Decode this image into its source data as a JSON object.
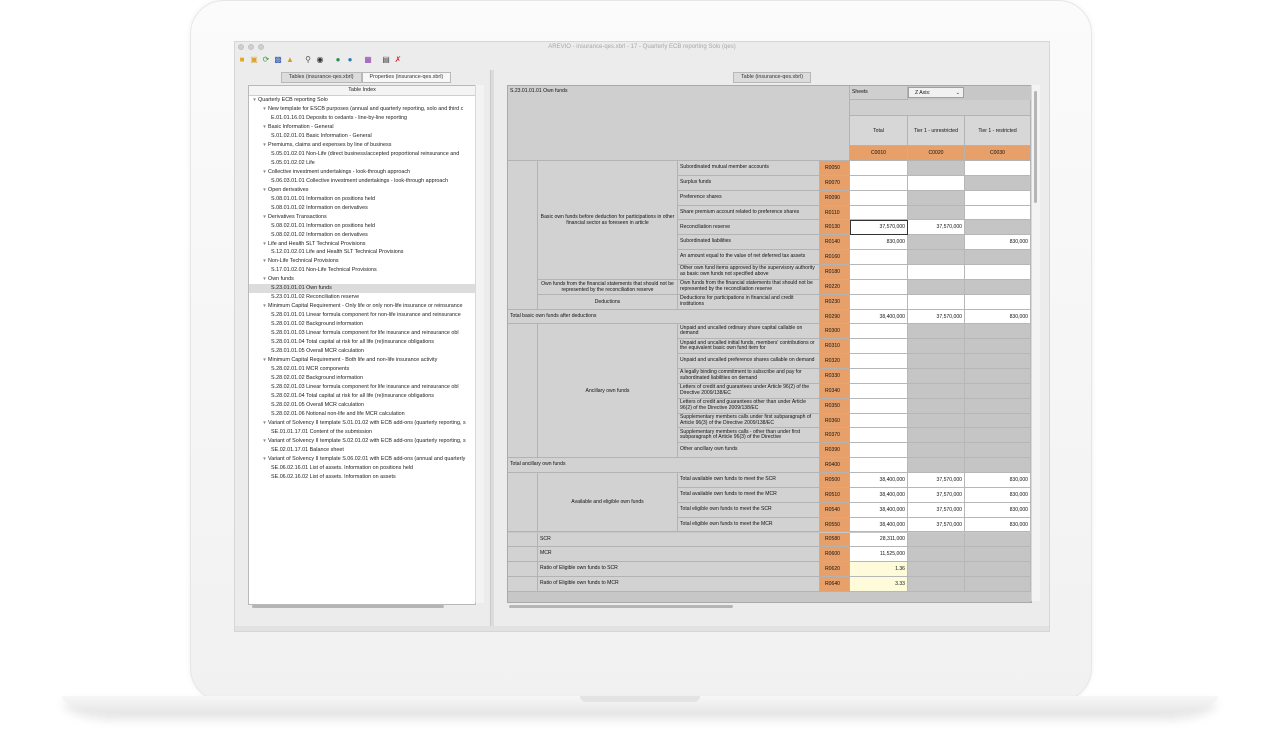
{
  "window": {
    "title": "AREVIO - insurance-qes.xbrl - 17 - Quarterly ECB reporting Solo (qes)"
  },
  "toolbar": {
    "icons": [
      "open-folder-icon",
      "open-file-icon",
      "refresh-icon",
      "save-icon",
      "export-icon",
      "search-icon",
      "binoculars-icon",
      "globe-add-icon",
      "globe-remove-icon",
      "calculator-icon",
      "paste-icon",
      "validation-icon"
    ]
  },
  "left_tabs": [
    {
      "label": "Tables (insurance-qes.xbrl)",
      "active": true
    },
    {
      "label": "Properties (insurance-qes.xbrl)",
      "active": false
    }
  ],
  "tree": {
    "header": "Table Index",
    "items": [
      {
        "label": "Quarterly ECB reporting Solo",
        "level": 0,
        "expanded": true
      },
      {
        "label": "New template for ESCB purposes (annual and quarterly reporting, solo and third c",
        "level": 1,
        "expanded": true
      },
      {
        "label": "E.01.01.16.01 Deposits to cedants - line-by-line reporting",
        "level": 2
      },
      {
        "label": "Basic Information - General",
        "level": 1,
        "expanded": true
      },
      {
        "label": "S.01.02.01.01 Basic Information - General",
        "level": 2
      },
      {
        "label": "Premiums, claims and expenses by line of business",
        "level": 1,
        "expanded": true
      },
      {
        "label": "S.05.01.02.01 Non-Life (direct business/accepted proportional reinsurance and",
        "level": 2
      },
      {
        "label": "S.05.01.02.02 Life",
        "level": 2
      },
      {
        "label": "Collective investment undertakings - look-through approach",
        "level": 1,
        "expanded": true
      },
      {
        "label": "S.06.03.01.01 Collective investment undertakings - look-through approach",
        "level": 2
      },
      {
        "label": "Open derivatives",
        "level": 1,
        "expanded": true
      },
      {
        "label": "S.08.01.01.01 Information on positions held",
        "level": 2
      },
      {
        "label": "S.08.01.01.02 Information on derivatives",
        "level": 2
      },
      {
        "label": "Derivatives Transactions",
        "level": 1,
        "expanded": true
      },
      {
        "label": "S.08.02.01.01 Information on positions held",
        "level": 2
      },
      {
        "label": "S.08.02.01.02 Information on derivatives",
        "level": 2
      },
      {
        "label": "Life and Health SLT Technical Provisions",
        "level": 1,
        "expanded": true
      },
      {
        "label": "S.12.01.02.01 Life and Health SLT Technical Provisions",
        "level": 2
      },
      {
        "label": "Non-Life Technical Provisions",
        "level": 1,
        "expanded": true
      },
      {
        "label": "S.17.01.02.01 Non-Life Technical Provisions",
        "level": 2
      },
      {
        "label": "Own funds",
        "level": 1,
        "expanded": true
      },
      {
        "label": "S.23.01.01.01 Own funds",
        "level": 2,
        "selected": true
      },
      {
        "label": "S.23.01.01.02 Reconciliation reserve",
        "level": 2
      },
      {
        "label": "Minimum Capital Requirement - Only life or only non-life insurance or reinsurance",
        "level": 1,
        "expanded": true
      },
      {
        "label": "S.28.01.01.01 Linear formula component for non-life insurance and reinsurance",
        "level": 2
      },
      {
        "label": "S.28.01.01.02 Background information",
        "level": 2
      },
      {
        "label": "S.28.01.01.03 Linear formula component for life insurance and reinsurance obl",
        "level": 2
      },
      {
        "label": "S.28.01.01.04 Total capital at risk for all life (re)insurance obligations",
        "level": 2
      },
      {
        "label": "S.28.01.01.05 Overall MCR calculation",
        "level": 2
      },
      {
        "label": "Minimum Capital Requirement - Both life and non-life insurance activity",
        "level": 1,
        "expanded": true
      },
      {
        "label": "S.28.02.01.01 MCR components",
        "level": 2
      },
      {
        "label": "S.28.02.01.02 Background information",
        "level": 2
      },
      {
        "label": "S.28.02.01.03 Linear formula component for life insurance and reinsurance obl",
        "level": 2
      },
      {
        "label": "S.28.02.01.04 Total capital at risk for all life (re)insurance obligations",
        "level": 2
      },
      {
        "label": "S.28.02.01.05 Overall MCR calculation",
        "level": 2
      },
      {
        "label": "S.28.02.01.06 Notional non-life and life MCR calculation",
        "level": 2
      },
      {
        "label": "Variant of Solvency II template S.01.01.02 with ECB add-ons (quarterly reporting, s",
        "level": 1,
        "expanded": true
      },
      {
        "label": "SE.01.01.17.01 Content of the submission",
        "level": 2
      },
      {
        "label": "Variant of Solvency II template S.02.01.02 with ECB add-ons (quarterly reporting, s",
        "level": 1,
        "expanded": true
      },
      {
        "label": "SE.02.01.17.01 Balance sheet",
        "level": 2
      },
      {
        "label": "Variant of Solvency II template S.06.02.01 with ECB add-ons (annual and quarterly",
        "level": 1,
        "expanded": true
      },
      {
        "label": "SE.06.02.16.01 List of assets. Information on positions held",
        "level": 2
      },
      {
        "label": "SE.06.02.16.02 List of assets. Information on assets",
        "level": 2
      }
    ]
  },
  "right_tab": {
    "label": "Table (insurance-qes.xbrl)"
  },
  "table": {
    "title": "S.23.01.01.01 Own funds",
    "sheets_label": "Sheets",
    "z_axis_label": "Z Axis:",
    "columns": [
      {
        "header": "Total",
        "code": "C0010"
      },
      {
        "header": "Tier 1 - unrestricted",
        "code": "C0020"
      },
      {
        "header": "Tier 1 - restricted",
        "code": "C0030"
      }
    ],
    "groups": {
      "basic": "Basic own funds before deduction for participations in other financial sector as foreseen in article",
      "own_funds_fs": "Own funds from the financial statements that should not be represented by the reconciliation reserve",
      "deductions": "Deductions",
      "total_basic": "Total basic own funds after deductions",
      "ancillary": "Ancillary own funds",
      "total_ancillary": "Total ancillary own funds",
      "available": "Available and eligible own funds",
      "scr": "SCR",
      "mcr": "MCR",
      "ratio_scr": "Ratio of Eligible own funds to SCR",
      "ratio_mcr": "Ratio of Eligible own funds to MCR"
    },
    "rows": [
      {
        "label": "Subordinated mutual member accounts",
        "code": "R0050",
        "values": [
          "",
          "",
          ""
        ],
        "shade": [
          "w",
          "g",
          "w"
        ]
      },
      {
        "label": "Surplus funds",
        "code": "R0070",
        "values": [
          "",
          "",
          ""
        ],
        "shade": [
          "w",
          "w",
          "g"
        ]
      },
      {
        "label": "Preference shares",
        "code": "R0090",
        "values": [
          "",
          "",
          ""
        ],
        "shade": [
          "w",
          "g",
          "w"
        ]
      },
      {
        "label": "Share premium account related to preference shares",
        "code": "R0110",
        "values": [
          "",
          "",
          ""
        ],
        "shade": [
          "w",
          "g",
          "w"
        ]
      },
      {
        "label": "Reconciliation reserve",
        "code": "R0130",
        "values": [
          "37,570,000",
          "37,570,000",
          ""
        ],
        "shade": [
          "o",
          "w",
          "g"
        ]
      },
      {
        "label": "Subordinated liabilities",
        "code": "R0140",
        "values": [
          "830,000",
          "",
          "830,000"
        ],
        "shade": [
          "w",
          "g",
          "w"
        ]
      },
      {
        "label": "An amount equal to the value of net deferred tax assets",
        "code": "R0160",
        "values": [
          "",
          "",
          ""
        ],
        "shade": [
          "w",
          "g",
          "g"
        ]
      },
      {
        "label": "Other own fund items approved by the supervisory authority as basic own funds not specified above",
        "code": "R0180",
        "values": [
          "",
          "",
          ""
        ],
        "shade": [
          "w",
          "w",
          "w"
        ]
      },
      {
        "label": "Own funds from the financial statements that should not be represented by the reconciliation reserve",
        "code": "R0220",
        "values": [
          "",
          "",
          ""
        ],
        "shade": [
          "w",
          "g",
          "g"
        ]
      },
      {
        "label": "Deductions for participations in financial and credit institutions",
        "code": "R0230",
        "values": [
          "",
          "",
          ""
        ],
        "shade": [
          "w",
          "w",
          "w"
        ]
      },
      {
        "label": "",
        "code": "R0290",
        "values": [
          "38,400,000",
          "37,570,000",
          "830,000"
        ],
        "shade": [
          "w",
          "w",
          "w"
        ]
      },
      {
        "label": "Unpaid and uncalled ordinary share capital callable on demand",
        "code": "R0300",
        "values": [
          "",
          "",
          ""
        ],
        "shade": [
          "w",
          "g",
          "g"
        ]
      },
      {
        "label": "Unpaid and uncalled initial funds, members' contributions or the equivalent basic own fund item for",
        "code": "R0310",
        "values": [
          "",
          "",
          ""
        ],
        "shade": [
          "w",
          "g",
          "g"
        ]
      },
      {
        "label": "Unpaid and uncalled preference shares callable on demand",
        "code": "R0320",
        "values": [
          "",
          "",
          ""
        ],
        "shade": [
          "w",
          "g",
          "g"
        ]
      },
      {
        "label": "A legally binding commitment to subscribe and pay for subordinated liabilities on demand",
        "code": "R0330",
        "values": [
          "",
          "",
          ""
        ],
        "shade": [
          "w",
          "g",
          "g"
        ]
      },
      {
        "label": "Letters of credit and guarantees under Article 96(2) of the Directive 2009/138/EC",
        "code": "R0340",
        "values": [
          "",
          "",
          ""
        ],
        "shade": [
          "w",
          "g",
          "g"
        ]
      },
      {
        "label": "Letters of credit and guarantees other than under Article 96(2) of the Directive 2009/138/EC",
        "code": "R0350",
        "values": [
          "",
          "",
          ""
        ],
        "shade": [
          "w",
          "g",
          "g"
        ]
      },
      {
        "label": "Supplementary members calls under first subparagraph of Article 96(3) of the Directive 2009/138/EC",
        "code": "R0360",
        "values": [
          "",
          "",
          ""
        ],
        "shade": [
          "w",
          "g",
          "g"
        ]
      },
      {
        "label": "Supplementary members calls - other than under first subparagraph of Article 96(3) of the Directive",
        "code": "R0370",
        "values": [
          "",
          "",
          ""
        ],
        "shade": [
          "w",
          "g",
          "g"
        ]
      },
      {
        "label": "Other ancillary own funds",
        "code": "R0390",
        "values": [
          "",
          "",
          ""
        ],
        "shade": [
          "w",
          "g",
          "g"
        ]
      },
      {
        "label": "",
        "code": "R0400",
        "values": [
          "",
          "",
          ""
        ],
        "shade": [
          "w",
          "g",
          "g"
        ]
      },
      {
        "label": "Total available own funds to meet the SCR",
        "code": "R0500",
        "values": [
          "38,400,000",
          "37,570,000",
          "830,000"
        ],
        "shade": [
          "w",
          "w",
          "w"
        ]
      },
      {
        "label": "Total available own funds to meet the MCR",
        "code": "R0510",
        "values": [
          "38,400,000",
          "37,570,000",
          "830,000"
        ],
        "shade": [
          "w",
          "w",
          "w"
        ]
      },
      {
        "label": "Total eligible own funds to meet the SCR",
        "code": "R0540",
        "values": [
          "38,400,000",
          "37,570,000",
          "830,000"
        ],
        "shade": [
          "w",
          "w",
          "w"
        ]
      },
      {
        "label": "Total eligible own funds to meet the MCR",
        "code": "R0550",
        "values": [
          "38,400,000",
          "37,570,000",
          "830,000"
        ],
        "shade": [
          "w",
          "w",
          "w"
        ]
      },
      {
        "label": "",
        "code": "R0580",
        "values": [
          "28,311,000",
          "",
          ""
        ],
        "shade": [
          "w",
          "g",
          "g"
        ]
      },
      {
        "label": "",
        "code": "R0600",
        "values": [
          "11,525,000",
          "",
          ""
        ],
        "shade": [
          "w",
          "g",
          "g"
        ]
      },
      {
        "label": "",
        "code": "R0620",
        "values": [
          "1.36",
          "",
          ""
        ],
        "shade": [
          "y",
          "g",
          "g"
        ]
      },
      {
        "label": "",
        "code": "R0640",
        "values": [
          "3.33",
          "",
          ""
        ],
        "shade": [
          "y",
          "g",
          "g"
        ]
      }
    ]
  }
}
